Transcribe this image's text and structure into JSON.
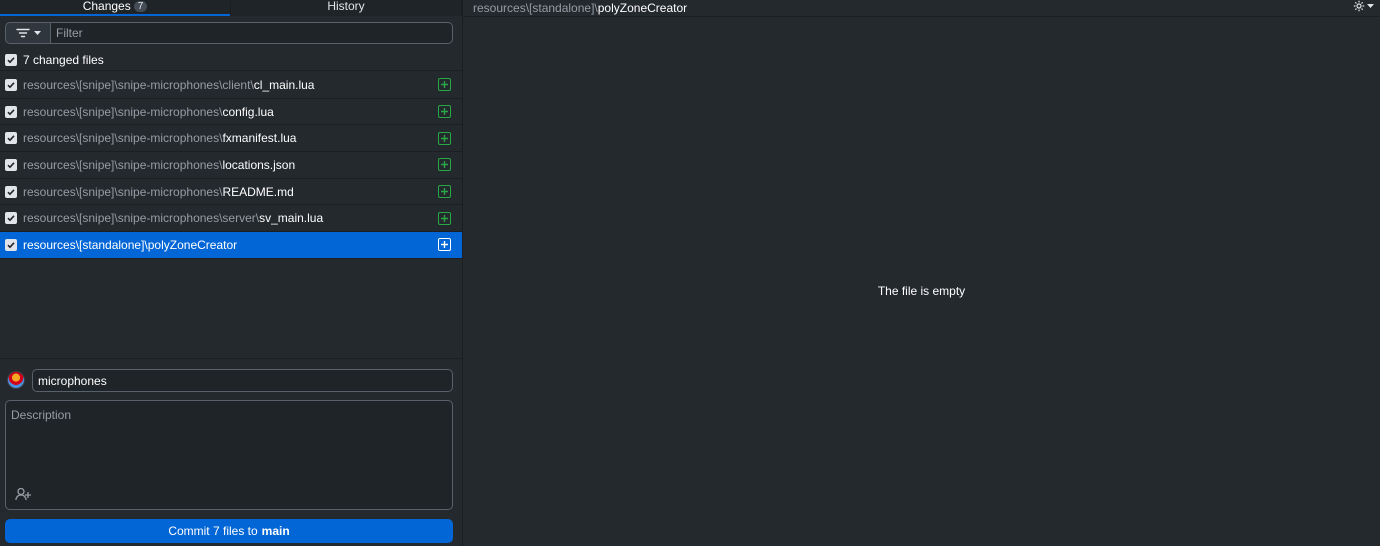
{
  "tabs": {
    "changes_label": "Changes",
    "changes_count": "7",
    "history_label": "History"
  },
  "filter": {
    "placeholder": "Filter"
  },
  "changes": {
    "header_label": "7 changed files",
    "files": [
      {
        "path": "resources\\[snipe]\\snipe-microphones\\client\\",
        "name": "cl_main.lua",
        "status": "added",
        "selected": false
      },
      {
        "path": "resources\\[snipe]\\snipe-microphones\\",
        "name": "config.lua",
        "status": "added",
        "selected": false
      },
      {
        "path": "resources\\[snipe]\\snipe-microphones\\",
        "name": "fxmanifest.lua",
        "status": "added",
        "selected": false
      },
      {
        "path": "resources\\[snipe]\\snipe-microphones\\",
        "name": "locations.json",
        "status": "added",
        "selected": false
      },
      {
        "path": "resources\\[snipe]\\snipe-microphones\\",
        "name": "README.md",
        "status": "added",
        "selected": false
      },
      {
        "path": "resources\\[snipe]\\snipe-microphones\\server\\",
        "name": "sv_main.lua",
        "status": "added",
        "selected": false
      },
      {
        "path": "resources\\[standalone]\\",
        "name": "polyZoneCreator",
        "status": "added",
        "selected": true
      }
    ]
  },
  "commit": {
    "summary_value": "microphones",
    "description_placeholder": "Description",
    "button_prefix": "Commit 7 files to",
    "button_branch": "main"
  },
  "diff": {
    "path": "resources\\[standalone]\\",
    "name": "polyZoneCreator",
    "empty_message": "The file is empty"
  },
  "colors": {
    "accent": "#0366d6",
    "added": "#28a745",
    "background": "#24292e"
  }
}
